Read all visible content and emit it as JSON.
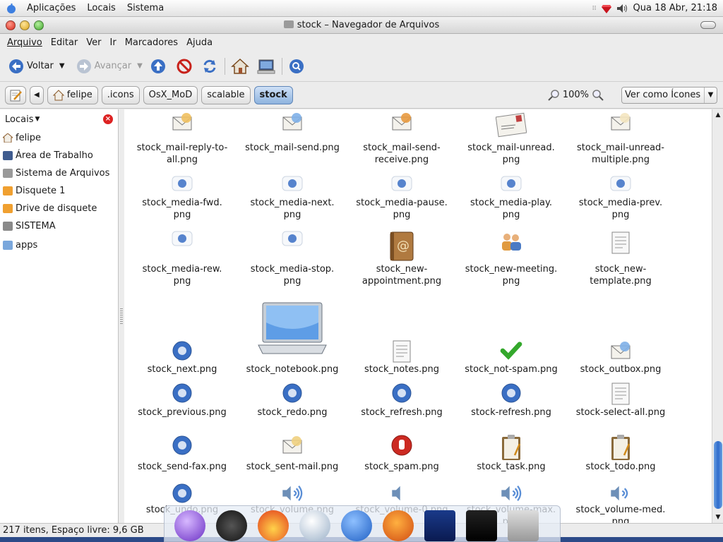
{
  "top_panel": {
    "menus": [
      "Aplicações",
      "Locais",
      "Sistema"
    ],
    "clock": "Qua 18 Abr, 21:18"
  },
  "window": {
    "title": "stock – Navegador de Arquivos"
  },
  "menubar": [
    "Arquivo",
    "Editar",
    "Ver",
    "Ir",
    "Marcadores",
    "Ajuda"
  ],
  "toolbar": {
    "back_label": "Voltar",
    "forward_label": "Avançar"
  },
  "pathbar": {
    "crumbs": [
      "felipe",
      ".icons",
      "OsX_MoD",
      "scalable",
      "stock"
    ],
    "zoom_level": "100%",
    "view_mode": "Ver como Ícones"
  },
  "sidebar": {
    "header": "Locais",
    "items": [
      "felipe",
      "Área de Trabalho",
      "Sistema de Arquivos",
      "Disquete 1",
      "Drive de disquete",
      "SISTEMA",
      "apps"
    ]
  },
  "files": [
    {
      "l1": "stock_mail-reply-to-",
      "l2": "all.png",
      "icon": "mail-reply-all-icon"
    },
    {
      "l1": "stock_mail-send.png",
      "l2": "",
      "icon": "mail-send-icon"
    },
    {
      "l1": "stock_mail-send-",
      "l2": "receive.png",
      "icon": "mail-send-receive-icon"
    },
    {
      "l1": "stock_mail-unread.",
      "l2": "png",
      "icon": "mail-unread-icon"
    },
    {
      "l1": "stock_mail-unread-",
      "l2": "multiple.png",
      "icon": "mail-unread-multiple-icon"
    },
    {
      "l1": "stock_media-fwd.",
      "l2": "png",
      "icon": "media-fwd-icon"
    },
    {
      "l1": "stock_media-next.",
      "l2": "png",
      "icon": "media-next-icon"
    },
    {
      "l1": "stock_media-pause.",
      "l2": "png",
      "icon": "media-pause-icon"
    },
    {
      "l1": "stock_media-play.",
      "l2": "png",
      "icon": "media-play-icon"
    },
    {
      "l1": "stock_media-prev.",
      "l2": "png",
      "icon": "media-prev-icon"
    },
    {
      "l1": "stock_media-rew.",
      "l2": "png",
      "icon": "media-rew-icon"
    },
    {
      "l1": "stock_media-stop.",
      "l2": "png",
      "icon": "media-stop-icon"
    },
    {
      "l1": "stock_new-",
      "l2": "appointment.png",
      "icon": "address-book-icon"
    },
    {
      "l1": "stock_new-meeting.",
      "l2": "png",
      "icon": "people-icon"
    },
    {
      "l1": "stock_new-",
      "l2": "template.png",
      "icon": "template-document-icon"
    },
    {
      "l1": "stock_next.png",
      "l2": "",
      "icon": "arrow-right-icon"
    },
    {
      "l1": "stock_notebook.png",
      "l2": "",
      "icon": "laptop-icon"
    },
    {
      "l1": "stock_notes.png",
      "l2": "",
      "icon": "notes-icon"
    },
    {
      "l1": "stock_not-spam.png",
      "l2": "",
      "icon": "checkmark-icon"
    },
    {
      "l1": "stock_outbox.png",
      "l2": "",
      "icon": "outbox-icon"
    },
    {
      "l1": "stock_previous.png",
      "l2": "",
      "icon": "arrow-left-icon"
    },
    {
      "l1": "stock_redo.png",
      "l2": "",
      "icon": "redo-icon"
    },
    {
      "l1": "stock_refresh.png",
      "l2": "",
      "icon": "refresh-icon"
    },
    {
      "l1": "stock-refresh.png",
      "l2": "",
      "icon": "refresh-icon"
    },
    {
      "l1": "stock-select-all.png",
      "l2": "",
      "icon": "select-all-icon"
    },
    {
      "l1": "stock_send-fax.png",
      "l2": "",
      "icon": "send-fax-icon"
    },
    {
      "l1": "stock_sent-mail.png",
      "l2": "",
      "icon": "sent-mail-icon"
    },
    {
      "l1": "stock_spam.png",
      "l2": "",
      "icon": "spam-icon"
    },
    {
      "l1": "stock_task.png",
      "l2": "",
      "icon": "clipboard-icon"
    },
    {
      "l1": "stock_todo.png",
      "l2": "",
      "icon": "clipboard-icon"
    },
    {
      "l1": "stock_undo.png",
      "l2": "",
      "icon": "undo-icon"
    },
    {
      "l1": "stock_volume.png",
      "l2": "",
      "icon": "volume-icon"
    },
    {
      "l1": "stock_volume-0.png",
      "l2": "",
      "icon": "volume-0-icon"
    },
    {
      "l1": "stock_volume-max.",
      "l2": "png",
      "icon": "volume-max-icon"
    },
    {
      "l1": "stock_volume-med.",
      "l2": "png",
      "icon": "volume-med-icon"
    }
  ],
  "status": {
    "text": "217 itens, Espaço livre: 9,6 GB"
  },
  "dock": [
    "launcher-icon",
    "camera-icon",
    "flame-icon",
    "itunes-icon",
    "mail-icon",
    "firefox-icon",
    "real-player-icon",
    "terminal-icon",
    "hard-drive-icon"
  ],
  "colors": {
    "accent": "#3a6fc4",
    "selected_crumb": "#8eb3de"
  }
}
